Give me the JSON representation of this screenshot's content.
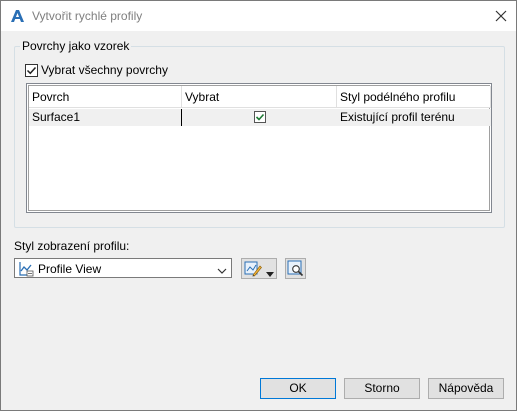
{
  "window": {
    "title": "Vytvořit rychlé profily"
  },
  "group": {
    "label": "Povrchy jako vzorek",
    "select_all_label": "Vybrat všechny povrchy",
    "select_all_checked": true
  },
  "grid": {
    "columns": [
      "Povrch",
      "Vybrat",
      "Styl podélného profilu"
    ],
    "rows": [
      {
        "surface": "Surface1",
        "selected": true,
        "style": "Existující profil terénu"
      }
    ]
  },
  "profile_view": {
    "label": "Styl zobrazení profilu:",
    "selected": "Profile View"
  },
  "buttons": {
    "ok": "OK",
    "cancel": "Storno",
    "help": "Nápověda"
  },
  "colors": {
    "accent": "#0078d7",
    "check": "#1e7b34",
    "icon_blue": "#2a6fb5"
  }
}
